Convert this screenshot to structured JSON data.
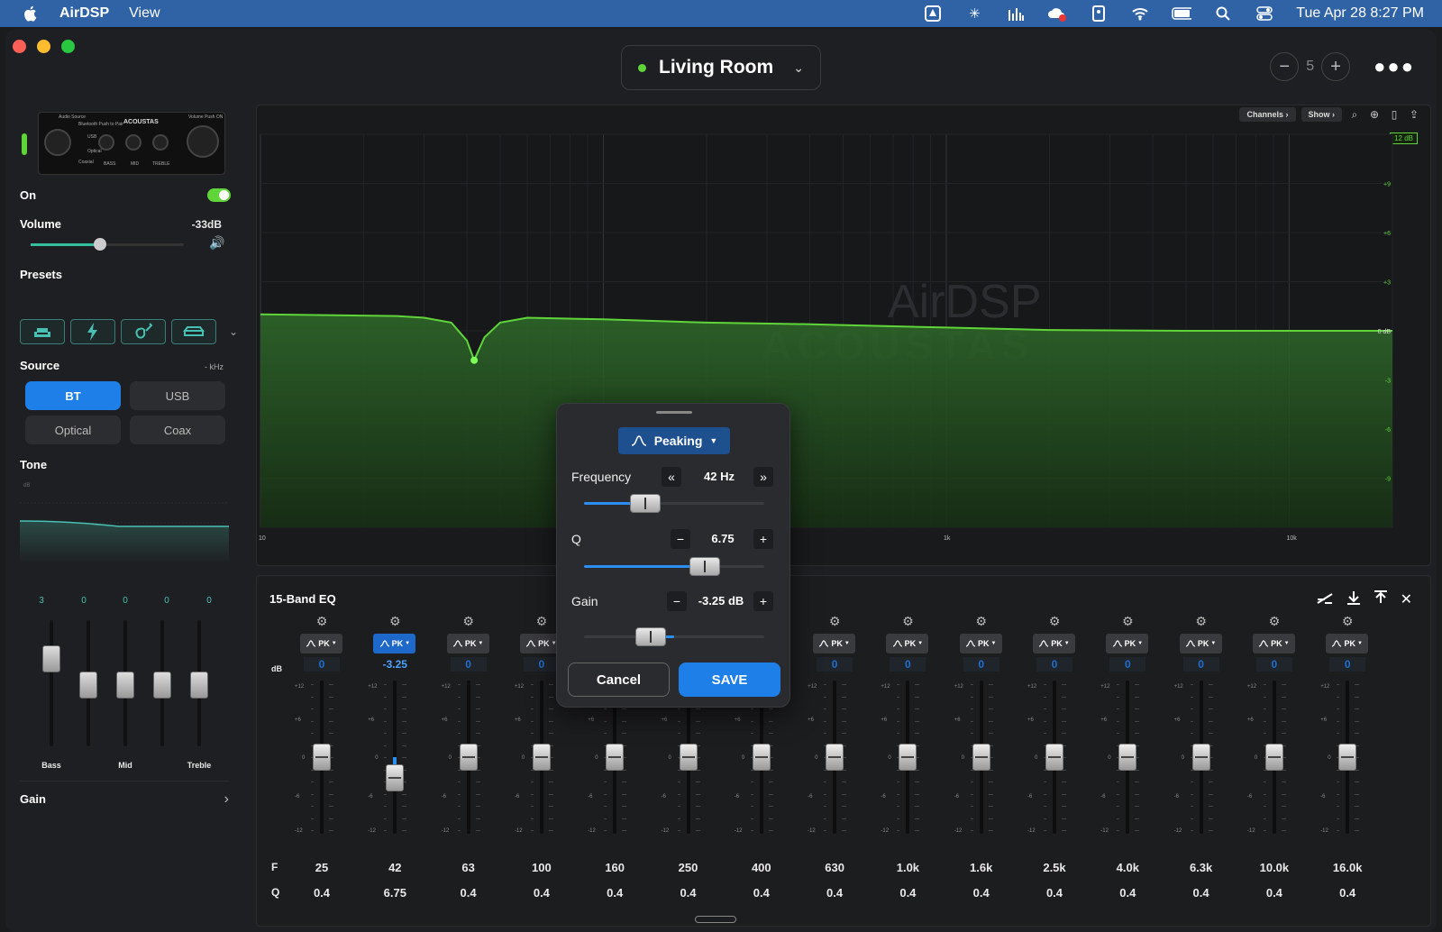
{
  "menubar": {
    "app": "AirDSP",
    "menu_view": "View",
    "datetime": "Tue Apr 28  8:27 PM"
  },
  "room": {
    "name": "Living Room"
  },
  "top": {
    "count": "5"
  },
  "sidebar": {
    "on_label": "On",
    "volume_label": "Volume",
    "volume_value": "-33dB",
    "volume_level": 0.45,
    "presets_label": "Presets",
    "source_label": "Source",
    "source_rate": "- kHz",
    "sources": [
      "BT",
      "USB",
      "Optical",
      "Coax"
    ],
    "tone_label": "Tone",
    "tone_db": "dB",
    "tone_values": [
      "3",
      "0",
      "0",
      "0",
      "0"
    ],
    "tone_labels": [
      "Bass",
      "Mid",
      "Treble"
    ],
    "gain_label": "Gain"
  },
  "device": {
    "audio_source": "Audio Source",
    "brand": "ACOUSTAS",
    "volume": "Volume Push ON",
    "bt": "Bluetooth Push to Pair",
    "usb": "USB",
    "optical": "Optical",
    "coaxial": "Coaxial",
    "bass": "BASS",
    "mid": "MID",
    "treble": "TREBLE"
  },
  "graph": {
    "tools": {
      "channels": "Channels",
      "show": "Show"
    },
    "db_range": "12 dB",
    "y_ticks": [
      "+9",
      "+6",
      "+3",
      "0 dB",
      "-3",
      "-6",
      "-9"
    ],
    "x_ticks": [
      "10",
      "1k",
      "10k"
    ],
    "watermark": "AirDSP",
    "watermark2": "ACOUSTAS"
  },
  "chart_data": {
    "type": "line",
    "title": "",
    "xlabel": "",
    "ylabel": "",
    "x_scale": "log",
    "xlim": [
      10,
      20000
    ],
    "ylim": [
      -12,
      12
    ],
    "grid": true,
    "series": [
      {
        "x": [
          10,
          25,
          30,
          36,
          40,
          42,
          45,
          50,
          60,
          100,
          200,
          400,
          1000,
          2000,
          5000,
          20000
        ],
        "values": [
          1.0,
          0.9,
          0.8,
          0.5,
          -0.6,
          -1.8,
          -0.4,
          0.5,
          0.8,
          0.7,
          0.5,
          0.4,
          0.2,
          0.05,
          0.0,
          0.0
        ]
      }
    ],
    "selected_point": {
      "x": 42,
      "y": -1.8
    }
  },
  "eq": {
    "title": "15-Band EQ",
    "db_label": "dB",
    "f_label": "F",
    "q_label": "Q",
    "ticks": [
      "+12",
      "+6",
      "0",
      "-6",
      "-12"
    ],
    "type_label": "PK",
    "bands": [
      {
        "f": "25",
        "q": "0.4",
        "gain": "0",
        "g": 0
      },
      {
        "f": "42",
        "q": "6.75",
        "gain": "-3.25",
        "g": -3.25
      },
      {
        "f": "63",
        "q": "0.4",
        "gain": "0",
        "g": 0
      },
      {
        "f": "100",
        "q": "0.4",
        "gain": "0",
        "g": 0
      },
      {
        "f": "160",
        "q": "0.4",
        "gain": "0",
        "g": 0
      },
      {
        "f": "250",
        "q": "0.4",
        "gain": "0",
        "g": 0
      },
      {
        "f": "400",
        "q": "0.4",
        "gain": "0",
        "g": 0
      },
      {
        "f": "630",
        "q": "0.4",
        "gain": "0",
        "g": 0
      },
      {
        "f": "1.0k",
        "q": "0.4",
        "gain": "0",
        "g": 0
      },
      {
        "f": "1.6k",
        "q": "0.4",
        "gain": "0",
        "g": 0
      },
      {
        "f": "2.5k",
        "q": "0.4",
        "gain": "0",
        "g": 0
      },
      {
        "f": "4.0k",
        "q": "0.4",
        "gain": "0",
        "g": 0
      },
      {
        "f": "6.3k",
        "q": "0.4",
        "gain": "0",
        "g": 0
      },
      {
        "f": "10.0k",
        "q": "0.4",
        "gain": "0",
        "g": 0
      },
      {
        "f": "16.0k",
        "q": "0.4",
        "gain": "0",
        "g": 0
      }
    ]
  },
  "dialog": {
    "type": "Peaking",
    "freq_label": "Frequency",
    "freq_value": "42 Hz",
    "freq_level": 0.34,
    "q_label": "Q",
    "q_value": "6.75",
    "q_level": 0.67,
    "gain_label": "Gain",
    "gain_value": "-3.25 dB",
    "gain_level": 0.37,
    "cancel": "Cancel",
    "save": "SAVE"
  },
  "colors": {
    "accent": "#1e7fe8",
    "green": "#5fd53a",
    "teal": "#47c1b3"
  }
}
